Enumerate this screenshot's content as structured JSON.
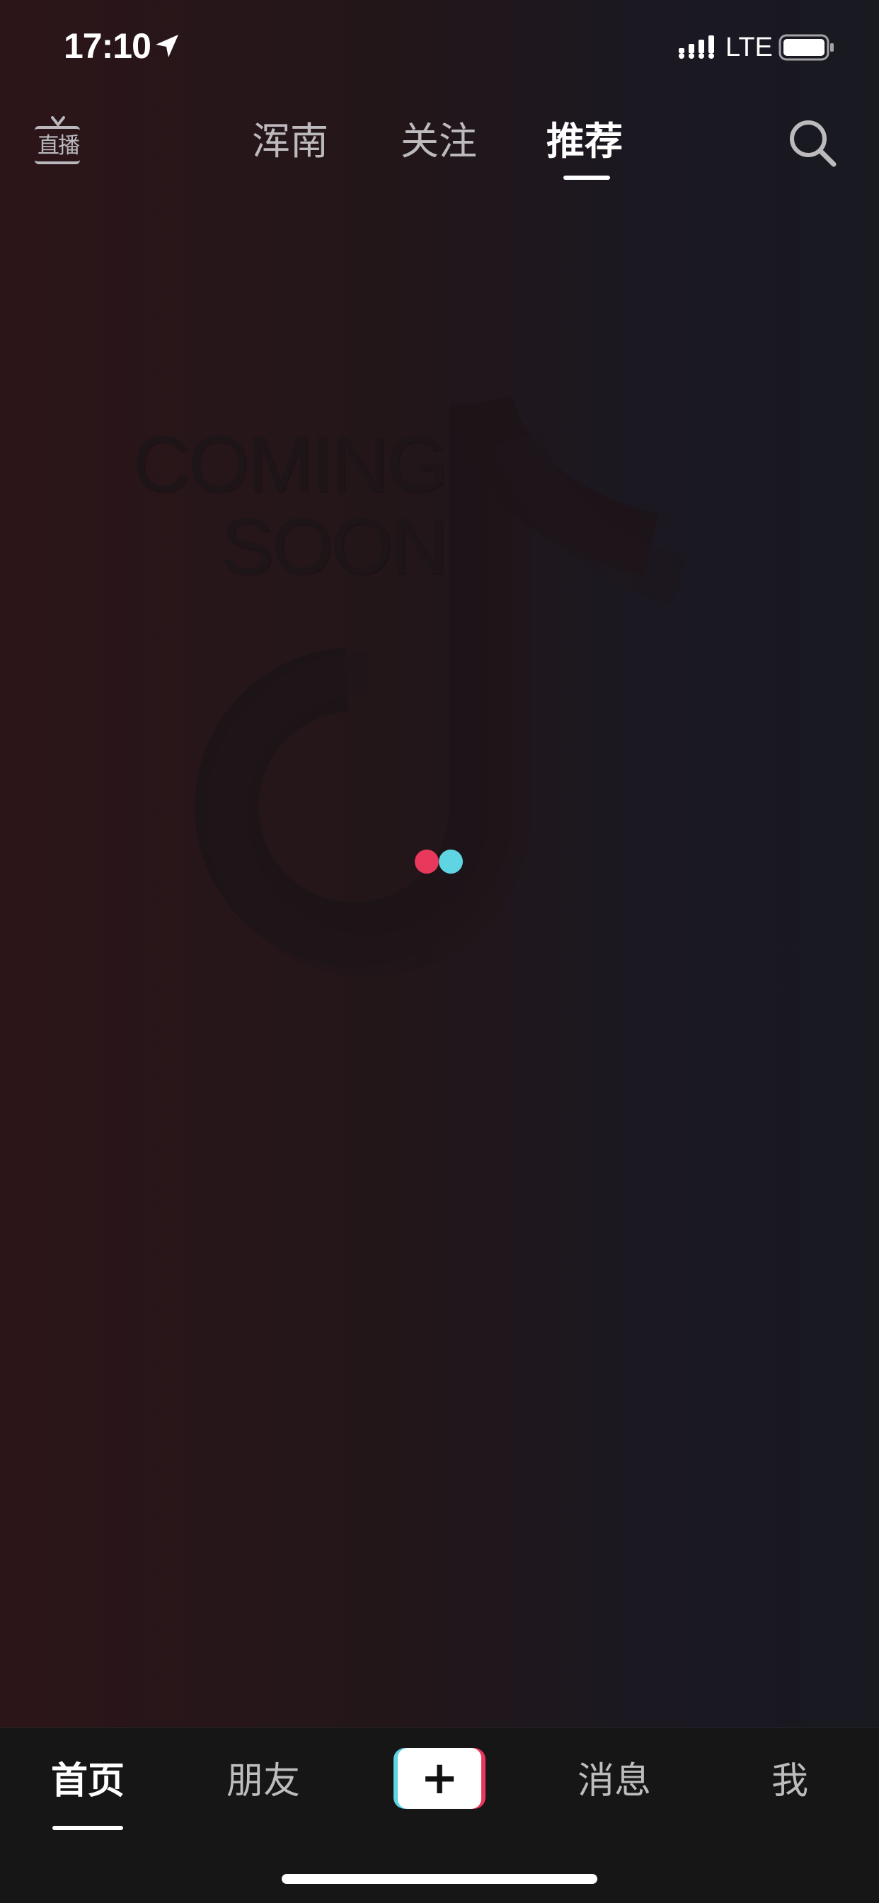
{
  "status_bar": {
    "time": "17:10",
    "network": "LTE",
    "icons": [
      "location-arrow-icon",
      "signal-icon",
      "battery-icon"
    ]
  },
  "top_nav": {
    "live_label": "直播",
    "tabs": [
      {
        "label": "浑南",
        "active": false
      },
      {
        "label": "关注",
        "active": false
      },
      {
        "label": "推荐",
        "active": true
      }
    ],
    "icons": [
      "tv-icon",
      "search-icon"
    ]
  },
  "placeholder": {
    "line1": "COMING",
    "line2": "SOON",
    "logo": "tiktok-note-icon",
    "loading_colors": [
      "#e8385c",
      "#5fd4e3"
    ]
  },
  "bottom_nav": {
    "tabs": [
      {
        "label": "首页",
        "active": true
      },
      {
        "label": "朋友",
        "active": false
      },
      {
        "label": "消息",
        "active": false
      },
      {
        "label": "我",
        "active": false
      }
    ],
    "create_icon": "plus-icon"
  },
  "colors": {
    "accent_red": "#e8385c",
    "accent_cyan": "#5fd4e3",
    "bar_background": "#161616"
  }
}
